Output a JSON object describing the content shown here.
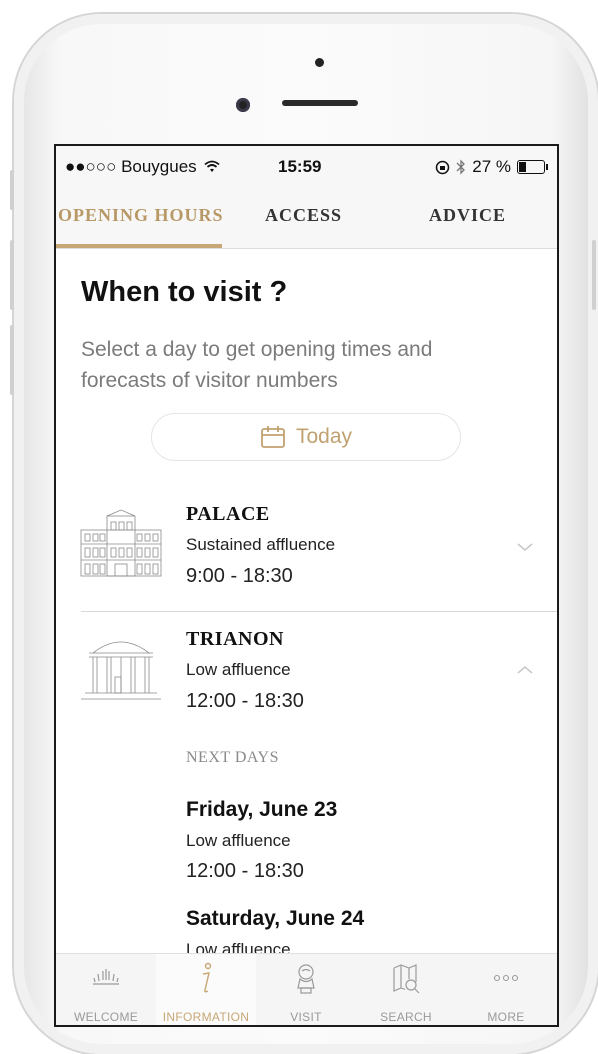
{
  "status_bar": {
    "carrier": "●●○○○ Bouygues",
    "time": "15:59",
    "battery": "27 %"
  },
  "tabs": [
    {
      "label": "OPENING HOURS",
      "active": true
    },
    {
      "label": "ACCESS",
      "active": false
    },
    {
      "label": "ADVICE",
      "active": false
    }
  ],
  "page": {
    "title": "When to visit ?",
    "subtitle": "Select a day to get opening times and forecasts of visitor numbers",
    "date_button": "Today"
  },
  "venues": [
    {
      "name": "PALACE",
      "affluence": "Sustained affluence",
      "hours": "9:00 - 18:30",
      "expanded": false,
      "icon": "palace-illustration"
    },
    {
      "name": "TRIANON",
      "affluence": "Low affluence",
      "hours": "12:00 - 18:30",
      "expanded": true,
      "icon": "trianon-illustration"
    }
  ],
  "next_days": {
    "heading": "NEXT DAYS",
    "days": [
      {
        "day": "Friday, June 23",
        "affluence": "Low affluence",
        "hours": "12:00 - 18:30"
      },
      {
        "day": "Saturday, June 24",
        "affluence": "Low affluence"
      }
    ]
  },
  "bottom_nav": [
    {
      "label": "WELCOME",
      "icon": "sunrise-icon",
      "active": false
    },
    {
      "label": "INFORMATION",
      "icon": "info-icon",
      "active": true
    },
    {
      "label": "VISIT",
      "icon": "bust-icon",
      "active": false
    },
    {
      "label": "SEARCH",
      "icon": "map-search-icon",
      "active": false
    },
    {
      "label": "MORE",
      "icon": "more-icon",
      "active": false
    }
  ],
  "colors": {
    "accent": "#c7a775",
    "muted_text": "#7b7b7b",
    "background": "#ffffff"
  }
}
